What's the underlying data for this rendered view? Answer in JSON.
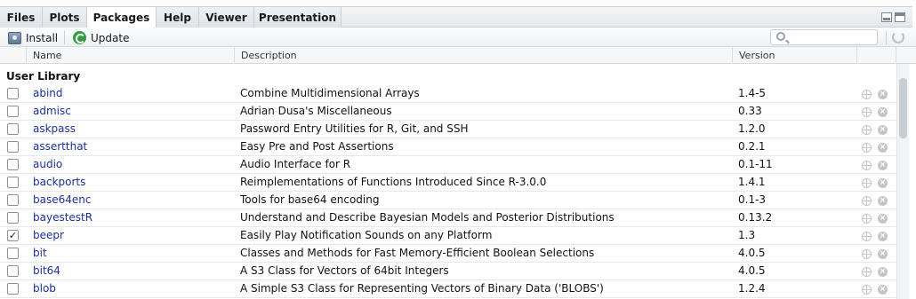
{
  "tabs": [
    {
      "label": "Files"
    },
    {
      "label": "Plots"
    },
    {
      "label": "Packages"
    },
    {
      "label": "Help"
    },
    {
      "label": "Viewer"
    },
    {
      "label": "Presentation"
    }
  ],
  "active_tab": "Packages",
  "toolbar": {
    "install_label": "Install",
    "update_label": "Update",
    "search_value": ""
  },
  "columns": {
    "name": "Name",
    "description": "Description",
    "version": "Version"
  },
  "group_label": "User Library",
  "packages": [
    {
      "name": "abind",
      "description": "Combine Multidimensional Arrays",
      "version": "1.4-5",
      "checked": false
    },
    {
      "name": "admisc",
      "description": "Adrian Dusa's Miscellaneous",
      "version": "0.33",
      "checked": false
    },
    {
      "name": "askpass",
      "description": "Password Entry Utilities for R, Git, and SSH",
      "version": "1.2.0",
      "checked": false
    },
    {
      "name": "assertthat",
      "description": "Easy Pre and Post Assertions",
      "version": "0.2.1",
      "checked": false
    },
    {
      "name": "audio",
      "description": "Audio Interface for R",
      "version": "0.1-11",
      "checked": false
    },
    {
      "name": "backports",
      "description": "Reimplementations of Functions Introduced Since R-3.0.0",
      "version": "1.4.1",
      "checked": false
    },
    {
      "name": "base64enc",
      "description": "Tools for base64 encoding",
      "version": "0.1-3",
      "checked": false
    },
    {
      "name": "bayestestR",
      "description": "Understand and Describe Bayesian Models and Posterior Distributions",
      "version": "0.13.2",
      "checked": false
    },
    {
      "name": "beepr",
      "description": "Easily Play Notification Sounds on any Platform",
      "version": "1.3",
      "checked": true
    },
    {
      "name": "bit",
      "description": "Classes and Methods for Fast Memory-Efficient Boolean Selections",
      "version": "4.0.5",
      "checked": false
    },
    {
      "name": "bit64",
      "description": "A S3 Class for Vectors of 64bit Integers",
      "version": "4.0.5",
      "checked": false
    },
    {
      "name": "blob",
      "description": "A Simple S3 Class for Representing Vectors of Binary Data ('BLOBS')",
      "version": "1.2.4",
      "checked": false
    }
  ],
  "icons": {
    "install": "install-package-icon",
    "update": "update-icon",
    "search": "search-icon",
    "refresh": "refresh-icon",
    "website": "globe-icon",
    "remove": "remove-icon"
  },
  "colors": {
    "link": "#1a2fa0",
    "update_green": "#2f9e3f"
  }
}
